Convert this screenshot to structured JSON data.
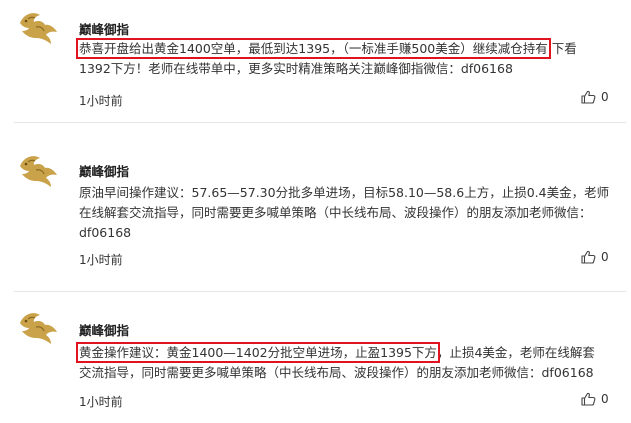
{
  "posts": [
    {
      "author": "巅峰御指",
      "lines": [
        {
          "segments": [
            {
              "text": "恭喜开盘给出黄金1400空单，最低到达1395，（一标准手赚500美金）继续减仓持有",
              "highlight": true
            },
            {
              "text": "  下看",
              "highlight": false
            }
          ]
        },
        {
          "segments": [
            {
              "text": "1392下方！老师在线带单中，更多实时精准策略关注巅峰御指微信：df06168",
              "highlight": false
            }
          ]
        }
      ],
      "time": "1小时前",
      "likes": "0"
    },
    {
      "author": "巅峰御指",
      "lines": [
        {
          "segments": [
            {
              "text": "原油早间操作建议：57.65—57.30分批多单进场，目标58.10—58.6上方，止损0.4美金，老师",
              "highlight": false
            }
          ]
        },
        {
          "segments": [
            {
              "text": "在线解套交流指导，同时需要更多喊单策略（中长线布局、波段操作）的朋友添加老师微信：",
              "highlight": false
            }
          ]
        },
        {
          "segments": [
            {
              "text": "df06168",
              "highlight": false
            }
          ]
        }
      ],
      "time": "1小时前",
      "likes": "0"
    },
    {
      "author": "巅峰御指",
      "lines": [
        {
          "segments": [
            {
              "text": "黄金操作建议：黄金1400—1402分批空单进场，止盈1395下方",
              "highlight": true
            },
            {
              "text": "，止损4美金，老师在线解套",
              "highlight": false
            }
          ]
        },
        {
          "segments": [
            {
              "text": "交流指导，同时需要更多喊单策略（中长线布局、波段操作）的朋友添加老师微信：df06168",
              "highlight": false
            }
          ]
        }
      ],
      "time": "1小时前",
      "likes": "0"
    }
  ],
  "icons": {
    "avatar": "golden-dragon-avatar-icon",
    "like": "thumbs-up-icon"
  },
  "colors": {
    "highlight_box": "#e0141e",
    "divider": "#e6e6e6",
    "avatar_gold": "#c9a24a"
  }
}
